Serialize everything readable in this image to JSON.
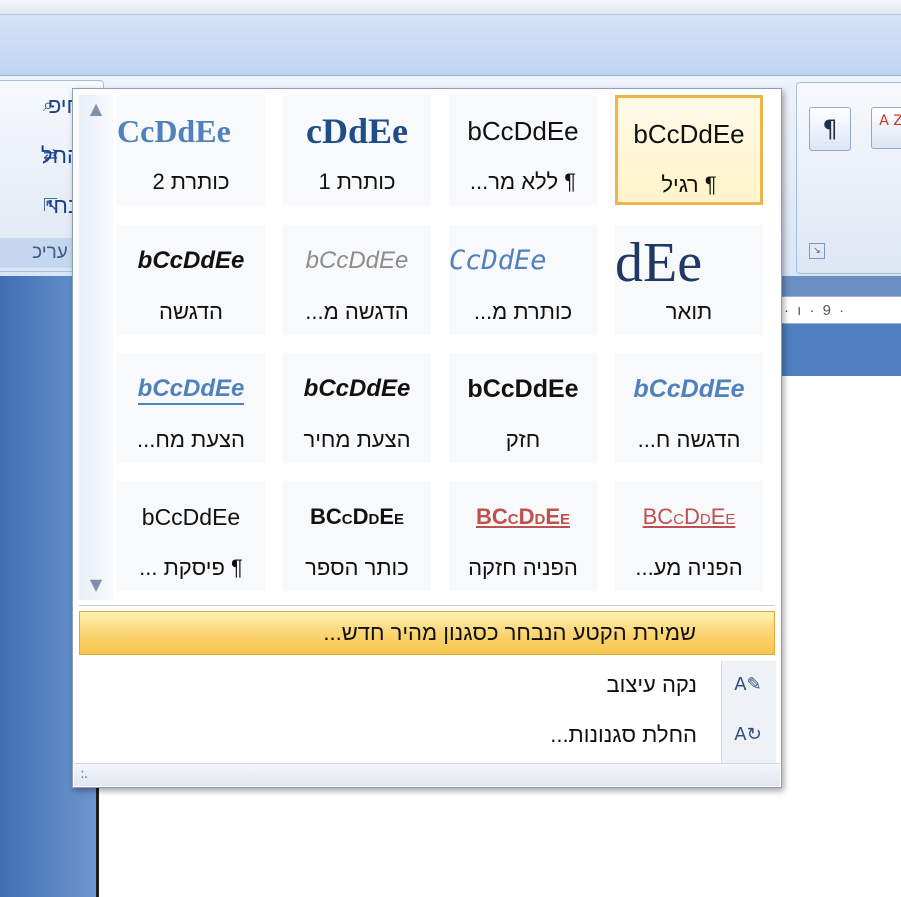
{
  "clipboard_group": {
    "items": [
      {
        "label": "חיפ",
        "icon": "find-icon"
      },
      {
        "label": "החל",
        "icon": "replace-icon"
      },
      {
        "label": "בחי",
        "icon": "select-icon"
      }
    ],
    "group_label": "עריכ"
  },
  "paragraph_group": {
    "buttons": [
      {
        "glyph": "¶",
        "icon": "show-marks-icon"
      },
      {
        "glyph": "A Z",
        "icon": "sort-icon"
      }
    ],
    "launcher_icon": "dialog-launcher-icon"
  },
  "ruler": {
    "text": "· ı · 9 ·"
  },
  "gallery": {
    "scroll_up": "▲",
    "scroll_down": "▼",
    "styles": [
      {
        "sample": "bCcDdEe",
        "label": "¶ רגיל",
        "class": "s-normal",
        "selected": true
      },
      {
        "sample": "bCcDdEe",
        "label": "¶ ללא מר...",
        "class": "s-normal",
        "selected": false
      },
      {
        "sample": "cDdEe",
        "label": "כותרת 1",
        "class": "s-h1",
        "selected": false
      },
      {
        "sample": "CcDdEe",
        "label": "כותרת 2",
        "class": "s-h2",
        "selected": false
      },
      {
        "sample": "dEe",
        "label": "תואר",
        "class": "s-title",
        "selected": false
      },
      {
        "sample": "CcDdEe",
        "label": "כותרת מ...",
        "class": "s-subtitle",
        "selected": false
      },
      {
        "sample": "bCcDdEe",
        "label": "הדגשה מ...",
        "class": "s-subtle",
        "selected": false
      },
      {
        "sample": "bCcDdEe",
        "label": "הדגשה",
        "class": "s-emph",
        "selected": false
      },
      {
        "sample": "bCcDdEe",
        "label": "הדגשה ח...",
        "class": "s-intense-emph",
        "selected": false
      },
      {
        "sample": "bCcDdEe",
        "label": "חזק",
        "class": "s-strong",
        "selected": false
      },
      {
        "sample": "bCcDdEe",
        "label": "הצעת מחיר",
        "class": "s-quote",
        "selected": false
      },
      {
        "sample": "bCcDdEe",
        "label": "הצעת מח...",
        "class": "s-intense-quote",
        "selected": false
      },
      {
        "sample": "BCcDdEe",
        "label": "הפניה מע...",
        "class": "s-subtle-ref",
        "selected": false
      },
      {
        "sample": "BCcDdEe",
        "label": "הפניה חזקה",
        "class": "s-intense-ref",
        "selected": false
      },
      {
        "sample": "BCcDdEe",
        "label": "כותר הספר",
        "class": "s-booktitle",
        "selected": false
      },
      {
        "sample": "bCcDdEe",
        "label": "¶ פיסקת ...",
        "class": "s-list",
        "selected": false
      }
    ],
    "save_selection_label": "שמירת הקטע הנבחר כסגנון מהיר חדש...",
    "clear_formatting_label": "נקה עיצוב",
    "apply_styles_label": "החלת סגנונות...",
    "clear_formatting_icon": "clear-formatting-icon",
    "apply_styles_icon": "apply-styles-icon",
    "resize_grip": ":."
  }
}
